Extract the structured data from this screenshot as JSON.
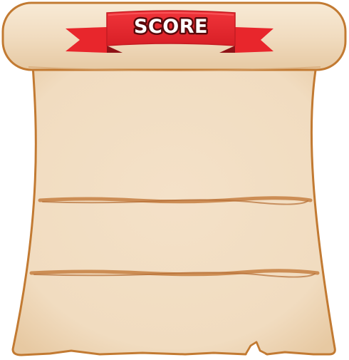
{
  "scoreboard": {
    "banner_label": "SCORE"
  },
  "colors": {
    "parchment": "#f3dfc4",
    "parchment_outline": "#c27a32",
    "ribbon_red": "#e8262c",
    "ribbon_dark": "#a0151b",
    "label_text": "#ffffff",
    "label_outline": "#5a0a0c"
  }
}
